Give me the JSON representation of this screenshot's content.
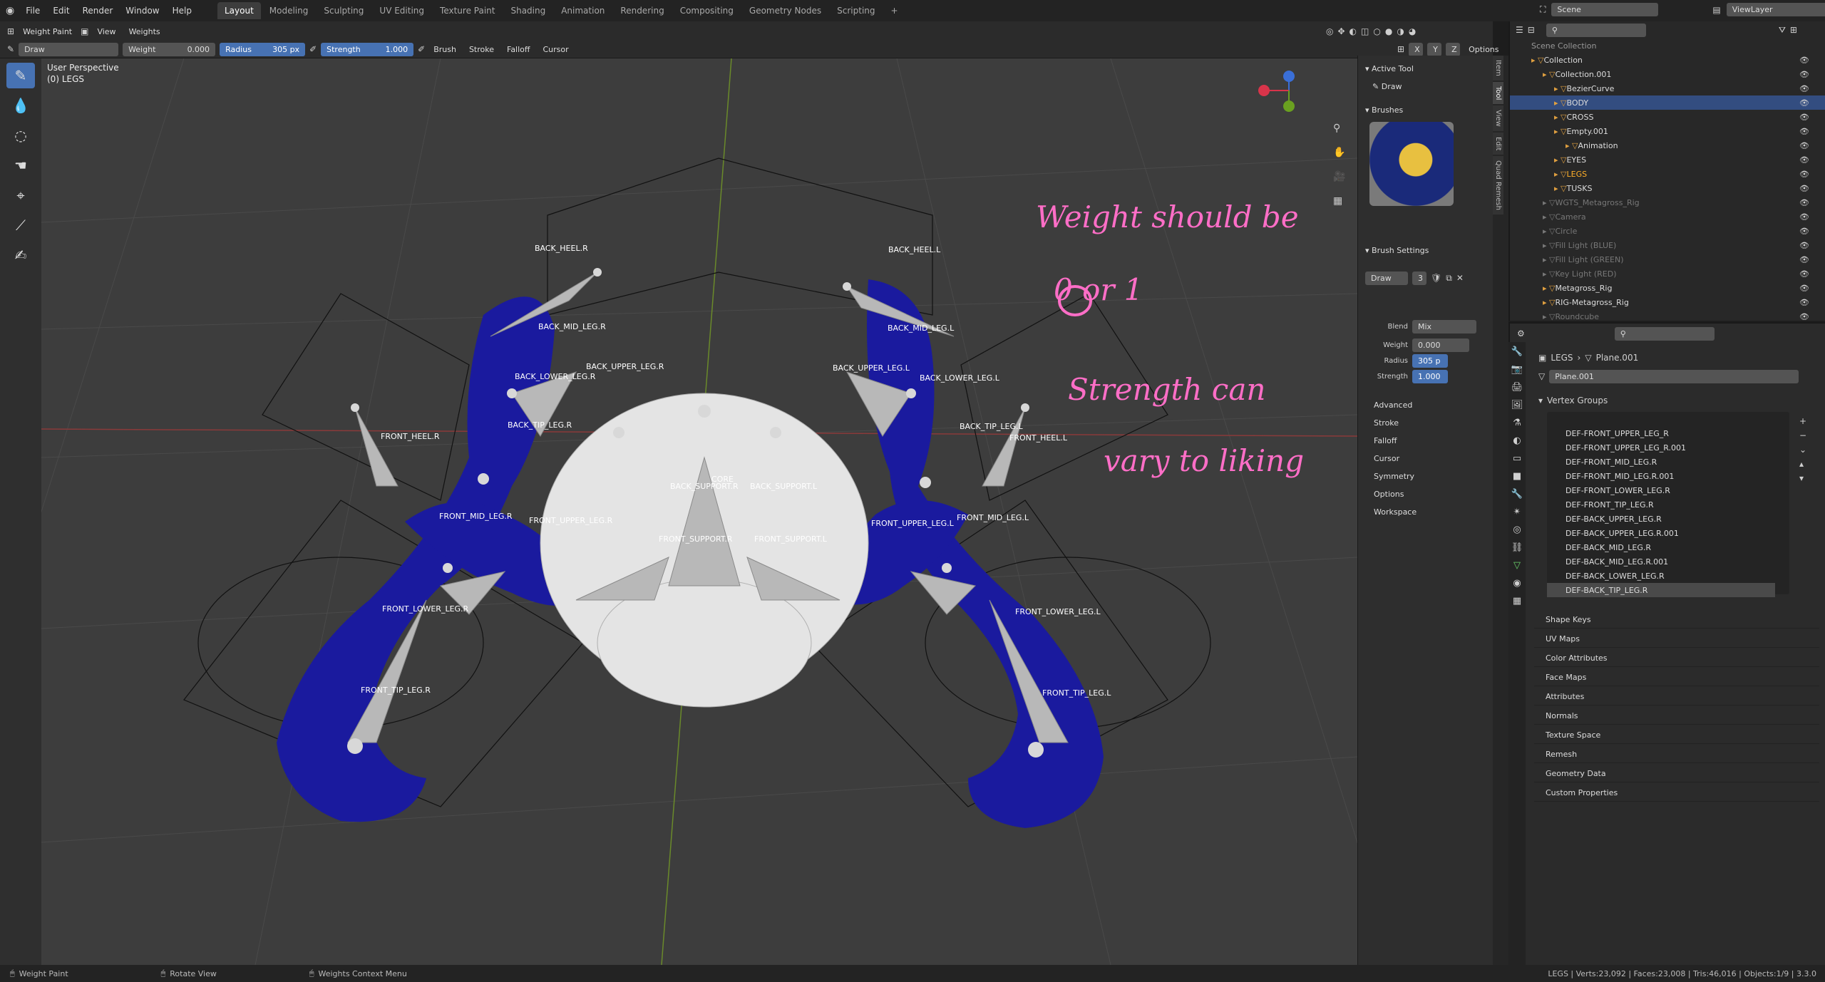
{
  "topbar": {
    "menus": [
      "File",
      "Edit",
      "Render",
      "Window",
      "Help"
    ],
    "workspaces": [
      "Layout",
      "Modeling",
      "Sculpting",
      "UV Editing",
      "Texture Paint",
      "Shading",
      "Animation",
      "Rendering",
      "Compositing",
      "Geometry Nodes",
      "Scripting"
    ],
    "active_workspace": "Layout",
    "scene": "Scene",
    "view_layer": "ViewLayer"
  },
  "header": {
    "mode": "Weight Paint",
    "view": "View",
    "weights": "Weights",
    "brush_name": "Draw",
    "weight_label": "Weight",
    "weight_value": "0.000",
    "radius_label": "Radius",
    "radius_value": "305 px",
    "strength_label": "Strength",
    "strength_value": "1.000",
    "brush": "Brush",
    "stroke": "Stroke",
    "falloff": "Falloff",
    "cursor": "Cursor",
    "options": "Options"
  },
  "viewport": {
    "perspective": "User Perspective",
    "object": "(0) LEGS"
  },
  "npanel": {
    "active_tool": "Active Tool",
    "tool_name": "Draw",
    "brushes": "Brushes",
    "brush_name": "Draw",
    "brush_users": "3",
    "brush_settings": "Brush Settings",
    "blend_label": "Blend",
    "blend_value": "Mix",
    "weight_label": "Weight",
    "weight_value": "0.000",
    "radius_label": "Radius",
    "radius_value": "305 p",
    "strength_label": "Strength",
    "strength_value": "1.000",
    "sections": [
      "Advanced",
      "Stroke",
      "Falloff",
      "Cursor",
      "Symmetry",
      "Options",
      "Workspace"
    ],
    "tabs": [
      "Item",
      "Tool",
      "View",
      "Edit",
      "Quad Remesh"
    ]
  },
  "annotations": {
    "line1": "Weight should be",
    "line2": "0 or 1",
    "line3": "Strength can",
    "line4": "vary to liking"
  },
  "bones": [
    "BACK_HEEL.R",
    "BACK_HEEL.L",
    "BACK_MID_LEG.R",
    "BACK_MID_LEG.L",
    "BACK_UPPER_LEG.R",
    "BACK_UPPER_LEG.L",
    "BACK_LOWER_LEG.R",
    "BACK_LOWER_LEG.L",
    "BACK_TIP_LEG.R",
    "BACK_TIP_LEG.L",
    "FRONT_HEEL.R",
    "FRONT_HEEL.L",
    "CORE",
    "BACK_SUPPORT.R",
    "BACK_SUPPORT.L",
    "FRONT_MID_LEG.R",
    "FRONT_MID_LEG.L",
    "FRONT_UPPER_LEG.R",
    "FRONT_UPPER_LEG.L",
    "FRONT_SUPPORT.R",
    "FRONT_SUPPORT.L",
    "FRONT_LOWER_LEG.R",
    "FRONT_LOWER_LEG.L",
    "FRONT_TIP_LEG.R",
    "FRONT_TIP_LEG.L"
  ],
  "outliner": {
    "root": "Scene Collection",
    "rows": [
      {
        "name": "Collection",
        "indent": 1
      },
      {
        "name": "Collection.001",
        "indent": 2
      },
      {
        "name": "BezierCurve",
        "indent": 3
      },
      {
        "name": "BODY",
        "indent": 3,
        "selected": true
      },
      {
        "name": "CROSS",
        "indent": 3
      },
      {
        "name": "Empty.001",
        "indent": 3
      },
      {
        "name": "Animation",
        "indent": 4
      },
      {
        "name": "EYES",
        "indent": 3
      },
      {
        "name": "LEGS",
        "indent": 3,
        "active": true
      },
      {
        "name": "TUSKS",
        "indent": 3
      },
      {
        "name": "WGTS_Metagross_Rig",
        "indent": 2,
        "dim": true
      },
      {
        "name": "Camera",
        "indent": 2,
        "dim": true
      },
      {
        "name": "Circle",
        "indent": 2,
        "dim": true
      },
      {
        "name": "Fill Light (BLUE)",
        "indent": 2,
        "dim": true
      },
      {
        "name": "Fill Light (GREEN)",
        "indent": 2,
        "dim": true
      },
      {
        "name": "Key Light (RED)",
        "indent": 2,
        "dim": true
      },
      {
        "name": "Metagross_Rig",
        "indent": 2
      },
      {
        "name": "RIG-Metagross_Rig",
        "indent": 2
      },
      {
        "name": "Roundcube",
        "indent": 2,
        "dim": true
      }
    ]
  },
  "properties": {
    "breadcrumb_obj": "LEGS",
    "breadcrumb_data": "Plane.001",
    "mesh_name": "Plane.001",
    "vertex_groups_title": "Vertex Groups",
    "vertex_groups": [
      "DEF-FRONT_UPPER_LEG_R",
      "DEF-FRONT_UPPER_LEG_R.001",
      "DEF-FRONT_MID_LEG.R",
      "DEF-FRONT_MID_LEG.R.001",
      "DEF-FRONT_LOWER_LEG.R",
      "DEF-FRONT_TIP_LEG.R",
      "DEF-BACK_UPPER_LEG.R",
      "DEF-BACK_UPPER_LEG.R.001",
      "DEF-BACK_MID_LEG.R",
      "DEF-BACK_MID_LEG.R.001",
      "DEF-BACK_LOWER_LEG.R",
      "DEF-BACK_TIP_LEG.R"
    ],
    "sections": [
      "Shape Keys",
      "UV Maps",
      "Color Attributes",
      "Face Maps",
      "Attributes",
      "Normals",
      "Texture Space",
      "Remesh",
      "Geometry Data",
      "Custom Properties"
    ]
  },
  "status": {
    "left": "Weight Paint",
    "mid": "Rotate View",
    "right": "Weights Context Menu",
    "stats": "LEGS | Verts:23,092 | Faces:23,008 | Tris:46,016 | Objects:1/9 | 3.3.0"
  },
  "colors": {
    "accent": "#4772b3",
    "mesh_blue": "#1a1a9e",
    "annotation": "#ff6ec7",
    "orange_mark": "#ff6a1a"
  }
}
